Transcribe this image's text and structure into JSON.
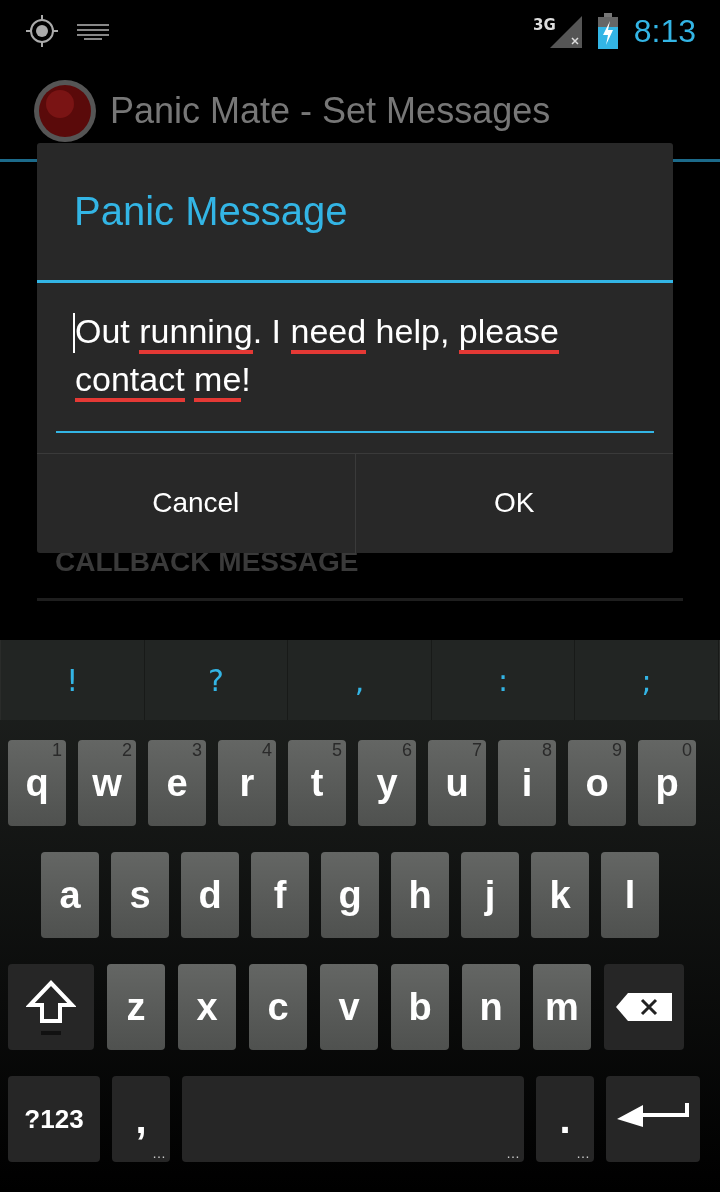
{
  "status_bar": {
    "network": "3G",
    "time": "8:13"
  },
  "action_bar": {
    "title": "Panic Mate - Set Messages"
  },
  "background_list": [
    {
      "kind": "header",
      "text": "CALLBACK MESSAGE"
    }
  ],
  "dialog": {
    "title": "Panic Message",
    "message": [
      {
        "text": "Out",
        "flagged": false
      },
      {
        "text": "running",
        "flagged": true,
        "punct": "."
      },
      {
        "text": "I",
        "flagged": false
      },
      {
        "text": "need",
        "flagged": true
      },
      {
        "text": "help,",
        "flagged": false
      },
      {
        "text": "please",
        "flagged": true
      },
      {
        "text": "contact",
        "flagged": true
      },
      {
        "text": "me",
        "flagged": true,
        "punct": "!"
      }
    ],
    "buttons": [
      "Cancel",
      "OK"
    ]
  },
  "keyboard": {
    "suggestions": [
      "!",
      "?",
      ",",
      ":",
      ";"
    ],
    "rows": [
      [
        {
          "kind": "letter",
          "label": "q",
          "hint": "1"
        },
        {
          "kind": "letter",
          "label": "w",
          "hint": "2"
        },
        {
          "kind": "letter",
          "label": "e",
          "hint": "3"
        },
        {
          "kind": "letter",
          "label": "r",
          "hint": "4"
        },
        {
          "kind": "letter",
          "label": "t",
          "hint": "5"
        },
        {
          "kind": "letter",
          "label": "y",
          "hint": "6"
        },
        {
          "kind": "letter",
          "label": "u",
          "hint": "7"
        },
        {
          "kind": "letter",
          "label": "i",
          "hint": "8"
        },
        {
          "kind": "letter",
          "label": "o",
          "hint": "9"
        },
        {
          "kind": "letter",
          "label": "p",
          "hint": "0"
        }
      ],
      [
        {
          "kind": "letter",
          "label": "a"
        },
        {
          "kind": "letter",
          "label": "s"
        },
        {
          "kind": "letter",
          "label": "d"
        },
        {
          "kind": "letter",
          "label": "f"
        },
        {
          "kind": "letter",
          "label": "g"
        },
        {
          "kind": "letter",
          "label": "h"
        },
        {
          "kind": "letter",
          "label": "j"
        },
        {
          "kind": "letter",
          "label": "k"
        },
        {
          "kind": "letter",
          "label": "l"
        }
      ],
      [
        {
          "kind": "shift"
        },
        {
          "kind": "letter",
          "label": "z"
        },
        {
          "kind": "letter",
          "label": "x"
        },
        {
          "kind": "letter",
          "label": "c"
        },
        {
          "kind": "letter",
          "label": "v"
        },
        {
          "kind": "letter",
          "label": "b"
        },
        {
          "kind": "letter",
          "label": "n"
        },
        {
          "kind": "letter",
          "label": "m"
        },
        {
          "kind": "delete"
        }
      ],
      [
        {
          "kind": "symbols",
          "label": "?123"
        },
        {
          "kind": "punct",
          "label": ",",
          "hint": "…"
        },
        {
          "kind": "space",
          "hint": "…"
        },
        {
          "kind": "punct",
          "label": ".",
          "hint": "…"
        },
        {
          "kind": "enter"
        }
      ]
    ]
  }
}
